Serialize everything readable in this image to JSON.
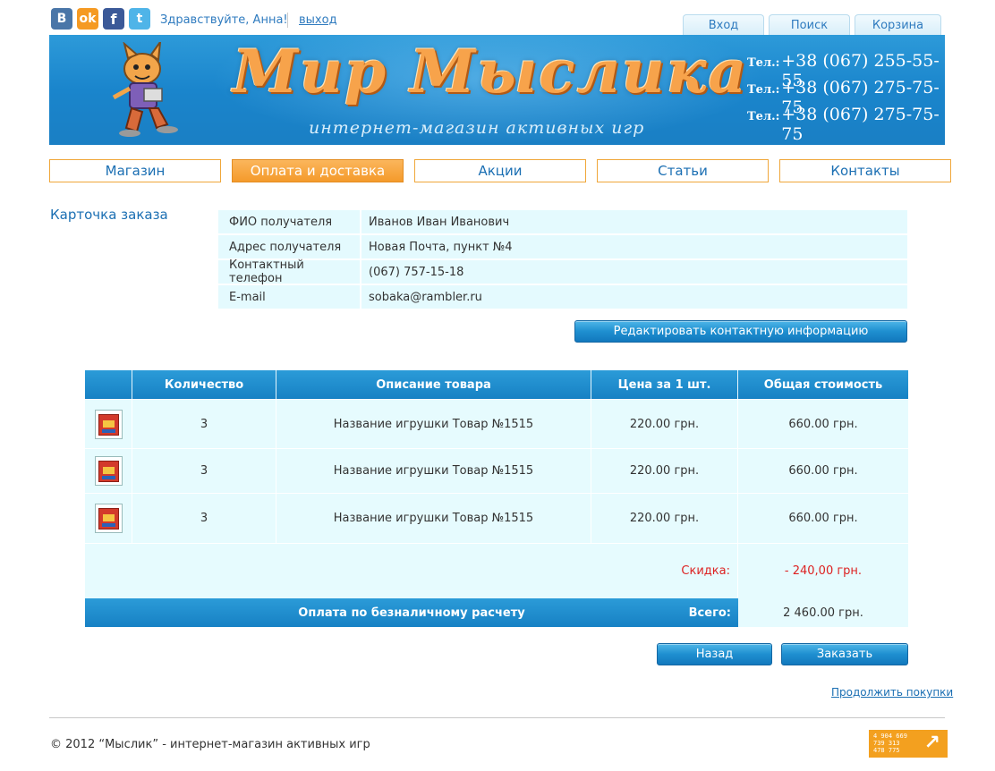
{
  "social": {
    "vk": "B",
    "ok": "ok",
    "fb": "f",
    "tw": "t"
  },
  "user": {
    "greeting": "Здравствуйте, Анна!",
    "logout": "выход"
  },
  "top_tabs": [
    "Вход",
    "Поиск",
    "Корзина"
  ],
  "banner": {
    "logo": "Мир Мыслика",
    "slogan": "интернет-магазин активных игр",
    "phone_label": "Тел.:",
    "phones": [
      "+38 (067) 255-55-55",
      "+38 (067) 275-75-75",
      "+38 (067) 275-75-75"
    ]
  },
  "nav": [
    "Магазин",
    "Оплата и доставка",
    "Акции",
    "Статьи",
    "Контакты"
  ],
  "nav_active_index": 1,
  "order_card": {
    "title": "Карточка заказа",
    "fields": [
      {
        "label": "ФИО получателя",
        "value": "Иванов Иван Иванович"
      },
      {
        "label": "Адрес получателя",
        "value": "Новая Почта, пункт №4"
      },
      {
        "label": "Контактный телефон",
        "value": "(067) 757-15-18"
      },
      {
        "label": "E-mail",
        "value": "sobaka@rambler.ru"
      }
    ],
    "edit_button": "Редактировать контактную информацию"
  },
  "order_table": {
    "headers": [
      "",
      "Количество",
      "Описание товара",
      "Цена за 1 шт.",
      "Общая стоимость"
    ],
    "rows": [
      {
        "qty": "3",
        "desc": "Название игрушки Товар №1515",
        "price": "220.00 грн.",
        "total": "660.00 грн."
      },
      {
        "qty": "3",
        "desc": "Название игрушки Товар №1515",
        "price": "220.00 грн.",
        "total": "660.00 грн."
      },
      {
        "qty": "3",
        "desc": "Название игрушки Товар №1515",
        "price": "220.00 грн.",
        "total": "660.00 грн."
      }
    ],
    "discount_label": "Скидка:",
    "discount_value": "- 240,00 грн.",
    "payment_method": "Оплата по безналичному расчету",
    "total_label": "Всего:",
    "total_value": "2 460.00 грн."
  },
  "buttons": {
    "back": "Назад",
    "order": "Заказать",
    "continue": "Продолжить покупки"
  },
  "footer": {
    "copyright": "© 2012 “Мыслик” - интернет-магазин активных игр",
    "counter_lines": [
      "4 904 669",
      "739 313",
      "478 775"
    ]
  },
  "colors": {
    "accent_blue": "#1b6fb3",
    "nav_orange": "#f49a2b",
    "row_bg": "#e6fbfe",
    "discount_red": "#dd2222"
  }
}
